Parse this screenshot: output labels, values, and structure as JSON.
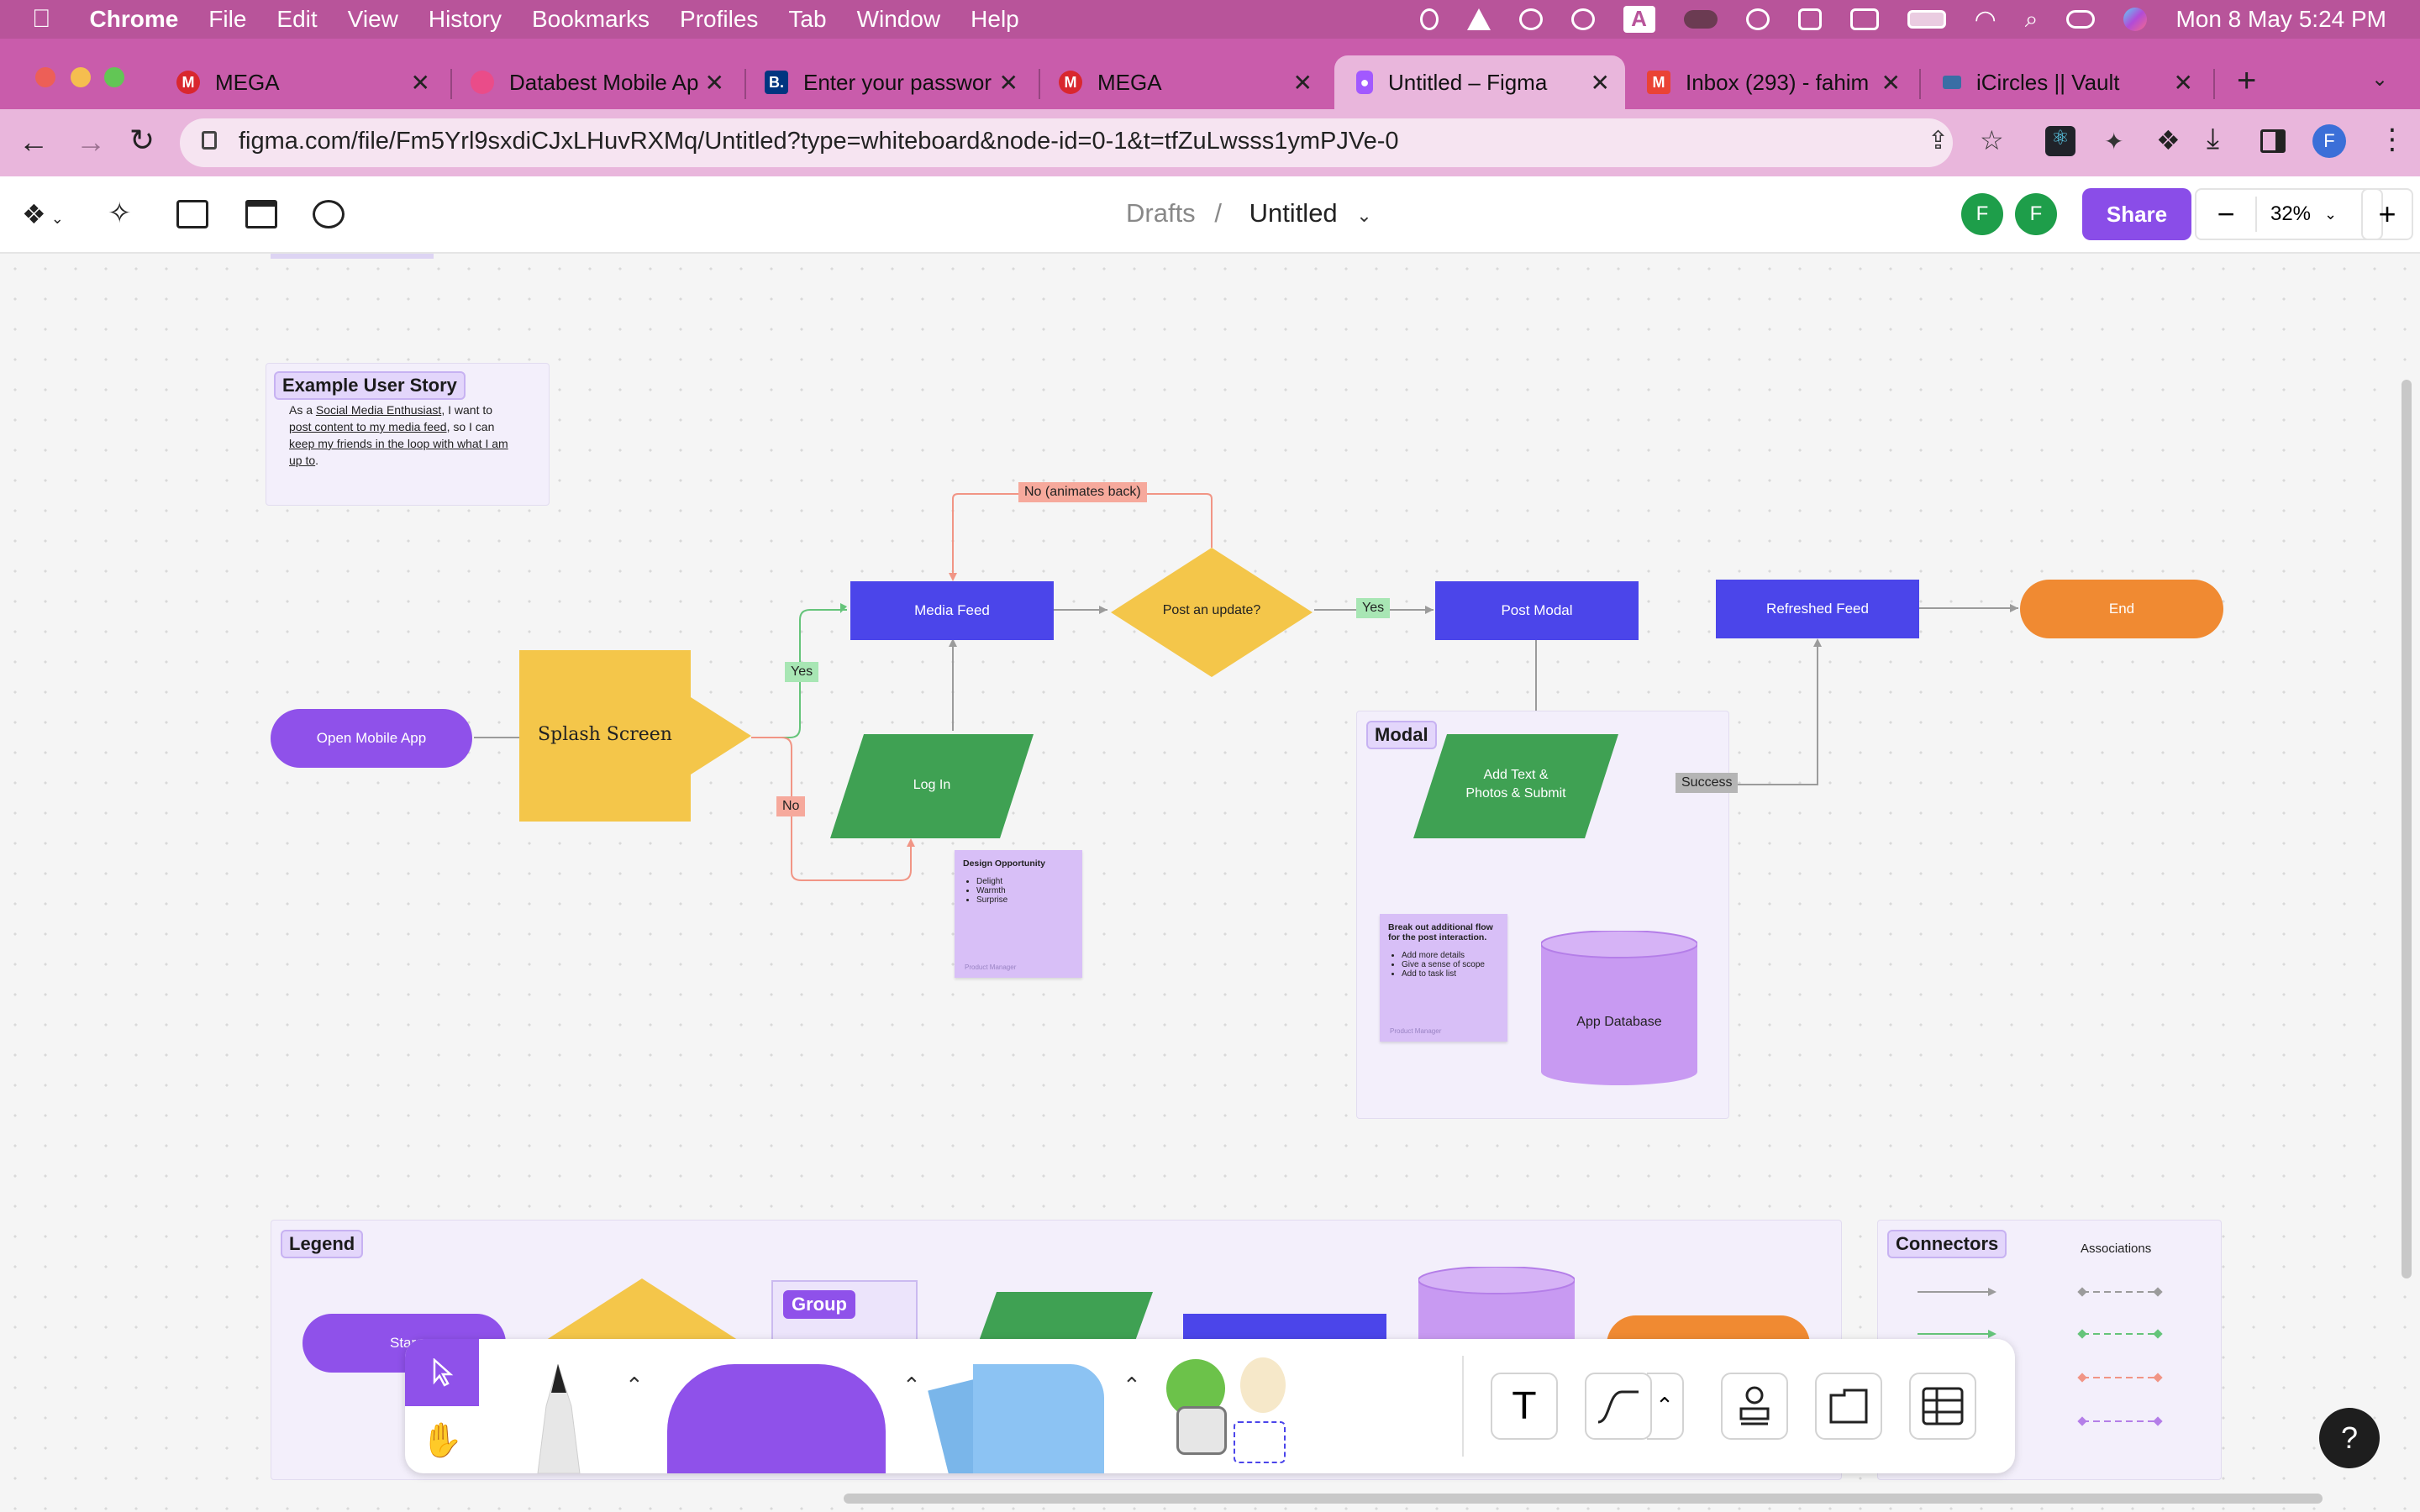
{
  "menubar": {
    "app": "Chrome",
    "items": [
      "File",
      "Edit",
      "View",
      "History",
      "Bookmarks",
      "Profiles",
      "Tab",
      "Window",
      "Help"
    ],
    "clock": "Mon 8 May  5:24 PM"
  },
  "tabs": [
    {
      "label": "MEGA",
      "icon": "mega-icon",
      "color": "#d9272e"
    },
    {
      "label": "Databest Mobile Ap",
      "icon": "dribbble-icon",
      "color": "#ea4c89"
    },
    {
      "label": "Enter your passwor",
      "icon": "booking-icon",
      "color": "#003580"
    },
    {
      "label": "MEGA",
      "icon": "mega-icon",
      "color": "#d9272e"
    },
    {
      "label": "Untitled – Figma",
      "icon": "figma-icon",
      "color": "#a259ff"
    },
    {
      "label": "Inbox (293) - fahim",
      "icon": "gmail-icon",
      "color": "#ea4335"
    },
    {
      "label": "iCircles || Vault",
      "icon": "vault-icon",
      "color": "#3a6ea5"
    }
  ],
  "address": {
    "url": "figma.com/file/Fm5Yrl9sxdiCJxLHuvRXMq/Untitled?type=whiteboard&node-id=0-1&t=tfZuLwsss1ymPJVe-0"
  },
  "browser": {
    "profile_initial": "F"
  },
  "figma": {
    "breadcrumb_root": "Drafts",
    "breadcrumb_sep": "/",
    "file_title": "Untitled",
    "avatars": [
      "F",
      "F"
    ],
    "share_label": "Share",
    "zoom": "32%"
  },
  "board": {
    "story": {
      "title": "Example User Story",
      "text": {
        "p1": "As a ",
        "persona": "Social Media Enthusiast",
        "p2": ", I want to ",
        "goal": "post content to my media feed",
        "p3": ", so I can ",
        "benefit": "keep my friends in the loop with what I am up to",
        "p4": "."
      }
    },
    "nodes": {
      "open_app": "Open Mobile App",
      "splash": "Splash Screen",
      "media_feed": "Media Feed",
      "post_update": "Post an update?",
      "post_modal": "Post Modal",
      "refreshed_feed": "Refreshed Feed",
      "end": "End",
      "log_in": "Log In",
      "add_text": "Add Text & Photos & Submit",
      "app_db": "App Database"
    },
    "labels": {
      "no_back": "No (animates back)",
      "yes1": "Yes",
      "yes2": "Yes",
      "no": "No",
      "success": "Success"
    },
    "modal_tag": "Modal",
    "sticky1": {
      "title": "Design Opportunity",
      "items": [
        "Delight",
        "Warmth",
        "Surprise"
      ],
      "author": "Product Manager"
    },
    "sticky2": {
      "title": "Break out additional flow for the post interaction.",
      "items": [
        "Add more details",
        "Give a sense of scope",
        "Add to task list"
      ],
      "author": "Product Manager"
    },
    "legend": {
      "title": "Legend",
      "group": "Group",
      "start_partial": "Star"
    },
    "connectors": {
      "title": "Connectors",
      "associations": "Associations"
    }
  },
  "colors": {
    "primary_blue": "#4b45ea",
    "decision_yellow": "#f4c64a",
    "process_green": "#3fa153",
    "terminal_purple": "#8f51ea",
    "end_orange": "#f08a32",
    "db_lilac": "#c89af2",
    "yes_label": "#a8e6b4",
    "no_label": "#f6a99c"
  },
  "help_label": "?"
}
